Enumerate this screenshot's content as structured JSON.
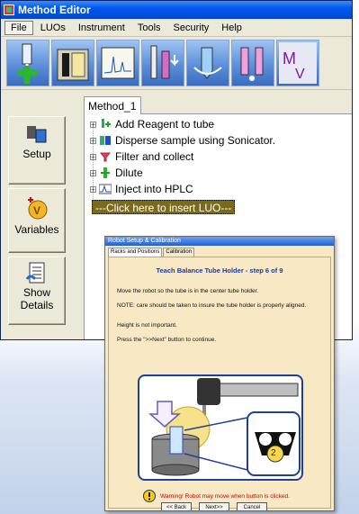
{
  "window": {
    "title": "Method Editor"
  },
  "menu": [
    "File",
    "LUOs",
    "Instrument",
    "Tools",
    "Security",
    "Help"
  ],
  "toolbar_icons": [
    "add-reagent-icon",
    "scanner-icon",
    "hplc-icon",
    "dispense-icon",
    "mixer-icon",
    "pipette-icon",
    "mv-icon"
  ],
  "side": {
    "setup": "Setup",
    "variables": "Variables",
    "show_details": "Show Details"
  },
  "tab_label": "Method_1",
  "tree": [
    "Add Reagent to tube",
    "Disperse sample using Sonicator.",
    "Filter and collect",
    "Dilute",
    "Inject into HPLC"
  ],
  "insert_text": "---Click here to insert LUO---",
  "dialog": {
    "title": "Robot Setup & Calibration",
    "tabs": [
      "Racks and Positions",
      "Calibration"
    ],
    "step_title": "Teach Balance Tube Holder - step 6 of 9",
    "line1": "Move the robot so the tube is in the center tube holder.",
    "line2": "NOTE: care should be taken to insure the tube holder is properly aligned.",
    "line3": "Height is not important.",
    "line4": "Press the \">>Next\" button to continue.",
    "position_number": "2",
    "warning": "Warning!  Robot may move when button is clicked.",
    "back": "<< Back",
    "next": "Next>>",
    "cancel": "Cancel"
  },
  "colors": {
    "title_blue": "#0058ee",
    "dialog_bg": "#f8e8c4",
    "warning_red": "#cc0000",
    "step_blue": "#1b3a9c"
  }
}
